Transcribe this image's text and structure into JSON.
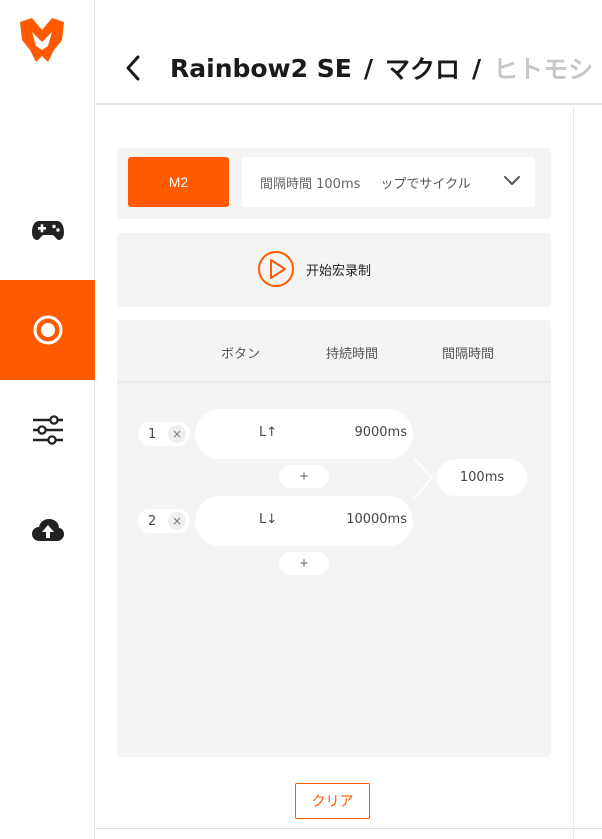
{
  "theme": {
    "accent": "#FF5A00",
    "panel_bg": "#F4F4F4"
  },
  "sidebar": {
    "items": [
      {
        "icon": "gamepad-icon",
        "active": false
      },
      {
        "icon": "record-macro-icon",
        "active": true
      },
      {
        "icon": "sliders-icon",
        "active": false
      },
      {
        "icon": "cloud-upload-icon",
        "active": false
      }
    ]
  },
  "header": {
    "breadcrumb": [
      "Rainbow2 SE",
      "マクロ",
      "ヒトモシ"
    ],
    "separator": "/"
  },
  "toolbar": {
    "macro_slot": "M2",
    "interval_text": "間隔時間 100ms",
    "mode_text": "ップでサイクル"
  },
  "record": {
    "label": "开始宏录制"
  },
  "table": {
    "headers": [
      "ボタン",
      "持続時間",
      "間隔時間"
    ],
    "rows": [
      {
        "index": "1",
        "delete": "×",
        "key": "L↑",
        "duration": "9000ms"
      },
      {
        "index": "2",
        "delete": "×",
        "key": "L↓",
        "duration": "10000ms"
      }
    ],
    "add_label": "+",
    "interval": "100ms"
  },
  "footer": {
    "clear_label": "クリア"
  }
}
